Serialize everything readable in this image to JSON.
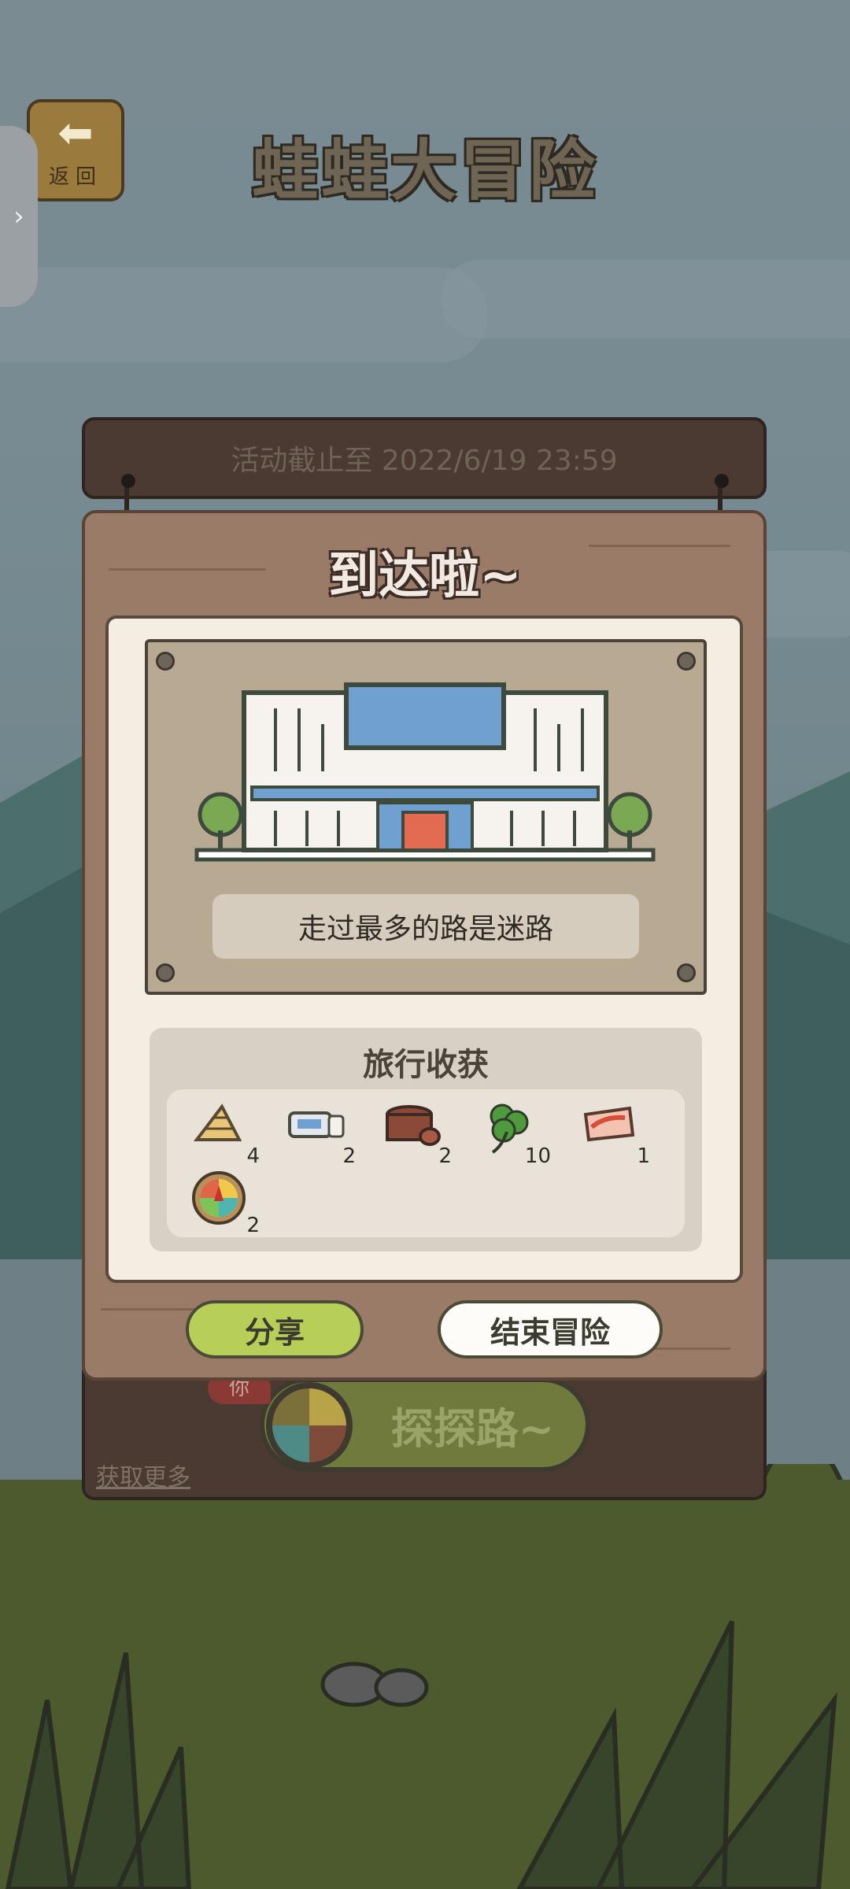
{
  "header": {
    "back_label": "返回",
    "game_title": "蛙蛙大冒险"
  },
  "deadline": {
    "text": "活动截止至 2022/6/19 23:59"
  },
  "dialog": {
    "title": "到达啦~",
    "caption": "走过最多的路是迷路",
    "harvest_title": "旅行收获",
    "items": [
      {
        "icon": "waffle-icon",
        "qty": "4"
      },
      {
        "icon": "ticket-icon",
        "qty": "2"
      },
      {
        "icon": "wood-log-icon",
        "qty": "2"
      },
      {
        "icon": "clover-icon",
        "qty": "10"
      },
      {
        "icon": "bacon-icon",
        "qty": "1"
      },
      {
        "icon": "compass-icon",
        "qty": "2"
      }
    ],
    "share_label": "分享",
    "end_label": "结束冒险"
  },
  "background": {
    "get_more": "获取更多",
    "explore_label": "探探路~",
    "you_badge": "你"
  }
}
